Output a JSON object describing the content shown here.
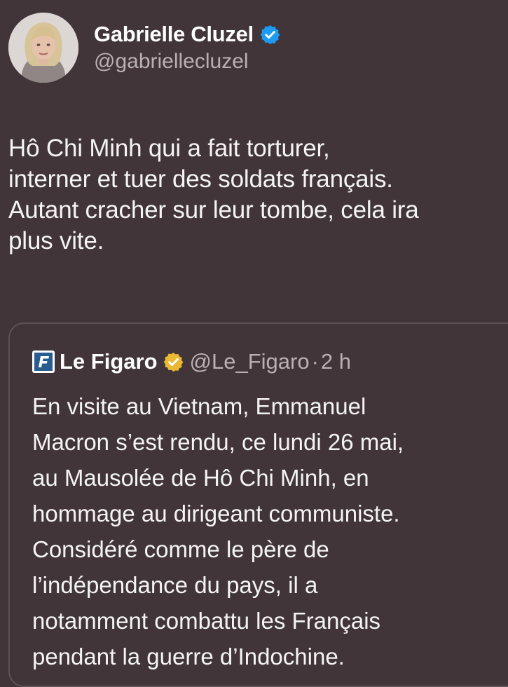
{
  "author": {
    "display_name": "Gabrielle Cluzel",
    "handle": "@gabriellecluzel",
    "verified_badge_color": "#1d9bf0"
  },
  "tweet": {
    "text": "Hô Chi Minh qui a fait torturer,\ninterner et tuer des soldats français.\nAutant cracher sur leur tombe, cela ira\nplus vite."
  },
  "quoted_tweet": {
    "account_name": "Le Figaro",
    "handle": "@Le_Figaro",
    "separator": "·",
    "time": "2 h",
    "verified_badge_color": "#e8b931",
    "logo_letter": "F",
    "text": "En visite au Vietnam, Emmanuel\nMacron s’est rendu, ce lundi 26 mai,\nau Mausolée de Hô Chi Minh, en\nhommage au dirigeant communiste.\nConsidéré comme le père de\nl’indépendance du pays, il a\nnotamment combattu les Français\npendant la guerre d’Indochine."
  },
  "colors": {
    "background": "#42353a",
    "text": "#f4f4f4",
    "secondary_text": "#b9b0b3",
    "border": "#5e5256"
  }
}
